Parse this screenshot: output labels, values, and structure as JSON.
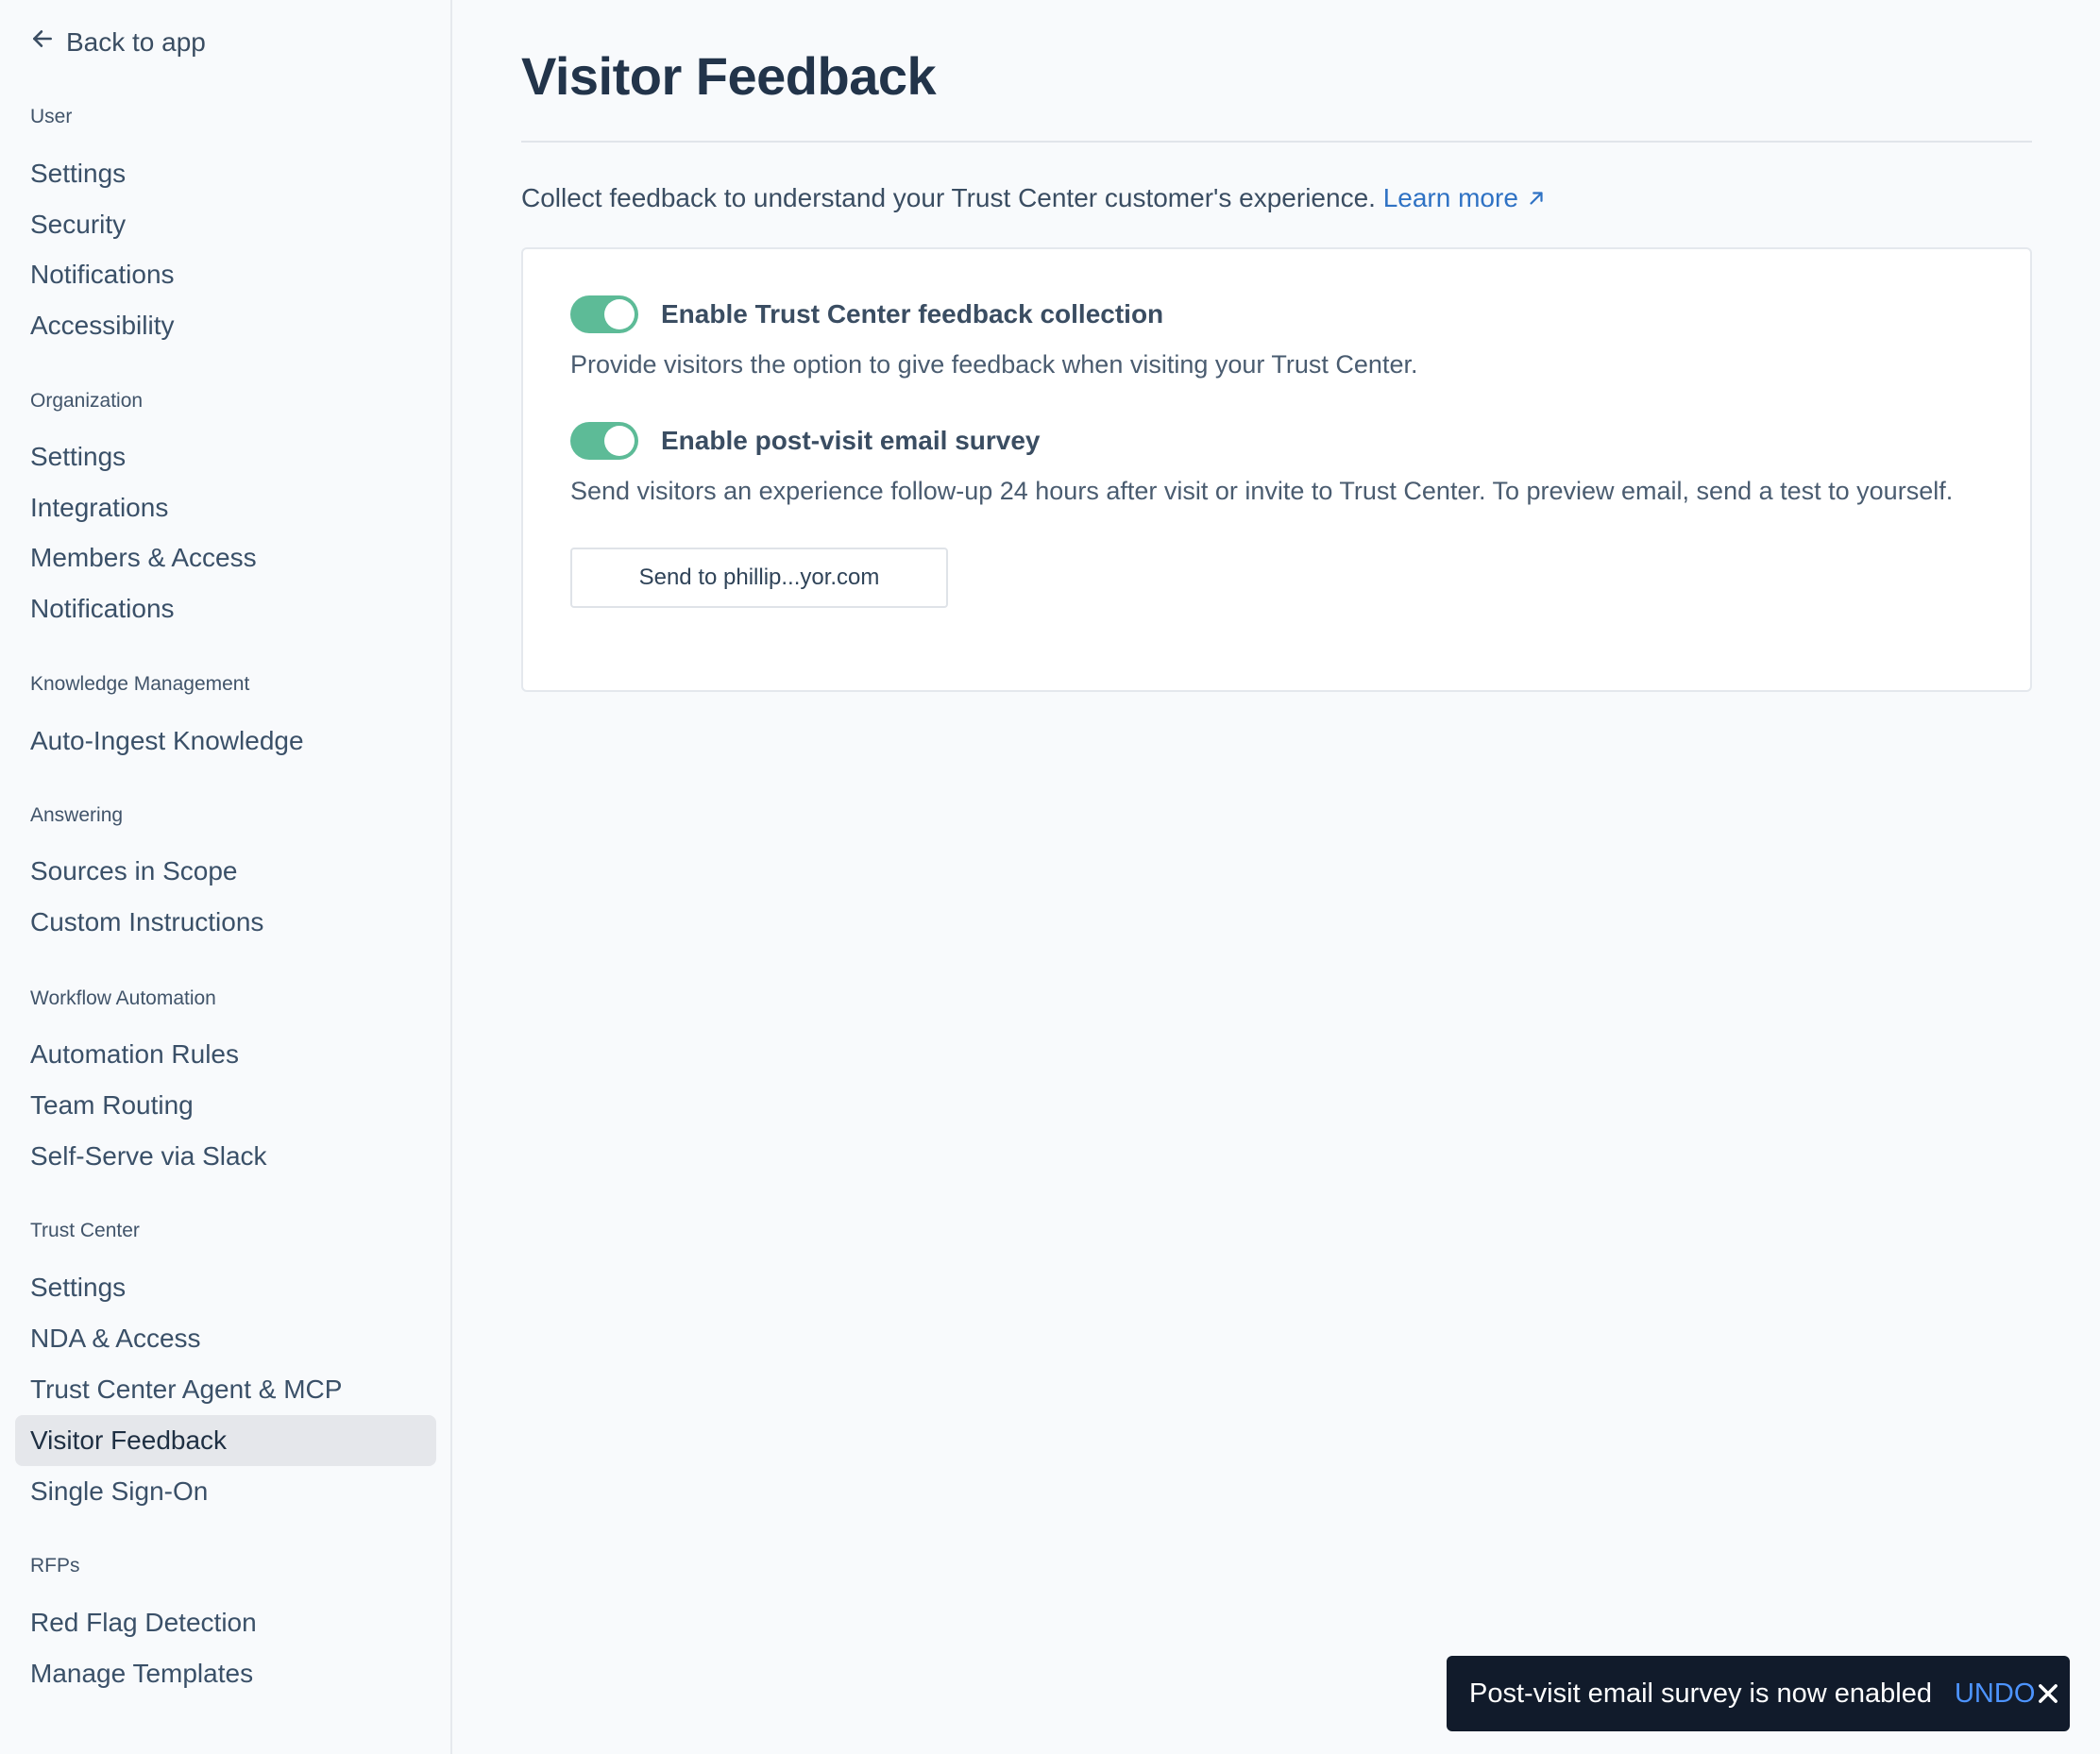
{
  "sidebar": {
    "back_label": "Back to app",
    "sections": [
      {
        "title": "User",
        "items": [
          "Settings",
          "Security",
          "Notifications",
          "Accessibility"
        ]
      },
      {
        "title": "Organization",
        "items": [
          "Settings",
          "Integrations",
          "Members & Access",
          "Notifications"
        ]
      },
      {
        "title": "Knowledge Management",
        "items": [
          "Auto-Ingest Knowledge"
        ]
      },
      {
        "title": "Answering",
        "items": [
          "Sources in Scope",
          "Custom Instructions"
        ]
      },
      {
        "title": "Workflow Automation",
        "items": [
          "Automation Rules",
          "Team Routing",
          "Self-Serve via Slack"
        ]
      },
      {
        "title": "Trust Center",
        "items": [
          "Settings",
          "NDA & Access",
          "Trust Center Agent & MCP",
          "Visitor Feedback",
          "Single Sign-On"
        ]
      },
      {
        "title": "RFPs",
        "items": [
          "Red Flag Detection",
          "Manage Templates"
        ]
      }
    ],
    "active_item": "Visitor Feedback"
  },
  "main": {
    "title": "Visitor Feedback",
    "intro": "Collect feedback to understand your Trust Center customer's experience.",
    "learn_more": "Learn more",
    "settings": [
      {
        "label": "Enable Trust Center feedback collection",
        "description": "Provide visitors the option to give feedback when visiting your Trust Center.",
        "enabled": true
      },
      {
        "label": "Enable post-visit email survey",
        "description": "Send visitors an experience follow-up 24 hours after visit or invite to Trust Center. To preview email, send a test to yourself.",
        "enabled": true
      }
    ],
    "test_button": "Send to phillip...yor.com"
  },
  "toast": {
    "message": "Post-visit email survey is now enabled",
    "action": "UNDO"
  },
  "colors": {
    "toggle_on": "#5dbb97",
    "link": "#2f72c4",
    "toast_bg": "#111b2b",
    "toast_action": "#4d94ff"
  },
  "icons": {
    "back": "arrow-left-icon",
    "external": "arrow-up-right-icon",
    "close": "close-icon"
  }
}
